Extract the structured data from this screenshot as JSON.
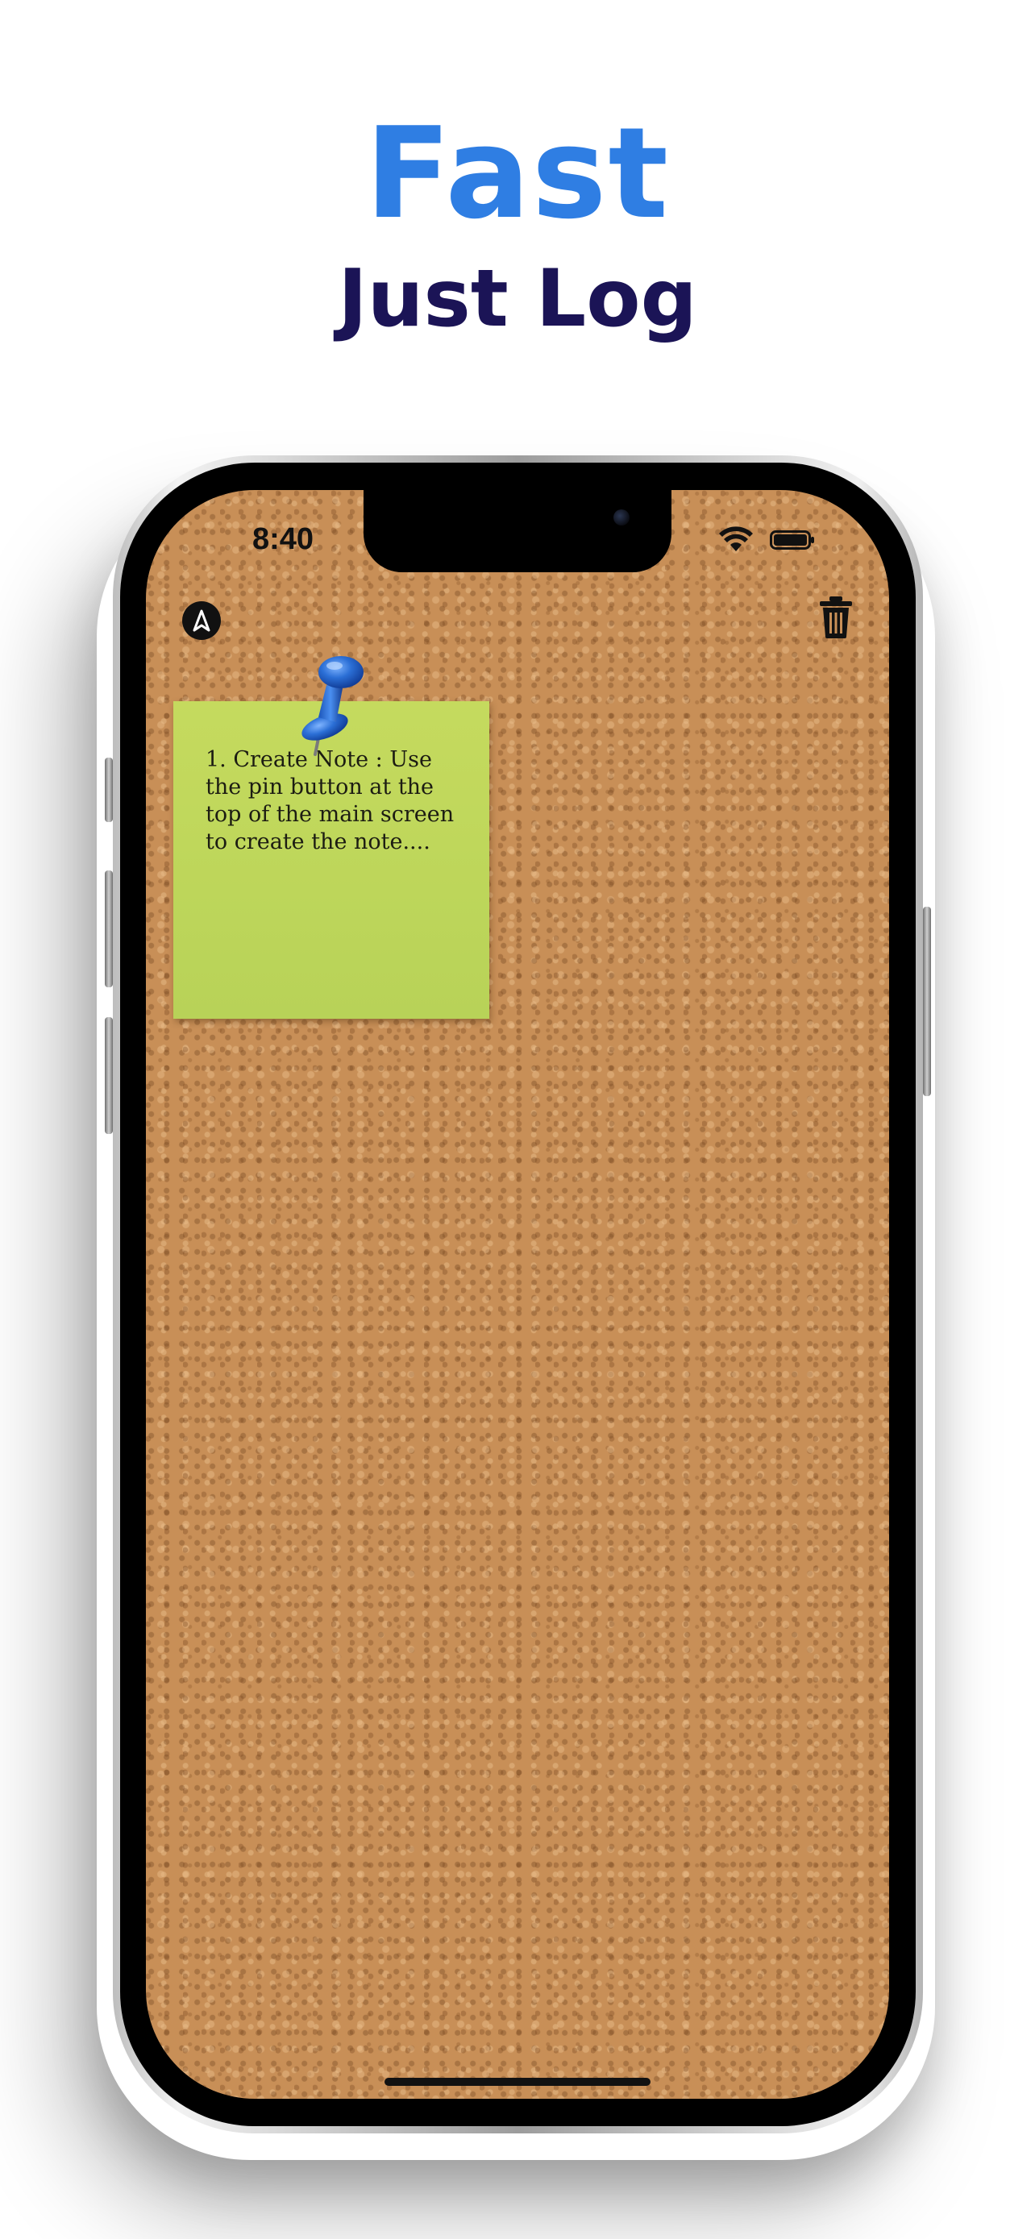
{
  "headline": {
    "main": "Fast",
    "sub": "Just Log"
  },
  "status_bar": {
    "time": "8:40",
    "wifi_icon": "wifi-icon",
    "battery_icon": "battery-icon"
  },
  "toolbar": {
    "left_icon": "compass-icon",
    "right_icon": "trash-icon"
  },
  "note": {
    "text": "1. Create Note : Use the pin button at the top of the main screen to create the note....",
    "color": "#c3d95d",
    "pin_icon": "pushpin-icon",
    "pin_color": "#2b6fd6"
  },
  "colors": {
    "headline_main": "#2f7ee3",
    "headline_sub": "#1b1456",
    "corkboard": "#c88f57"
  }
}
